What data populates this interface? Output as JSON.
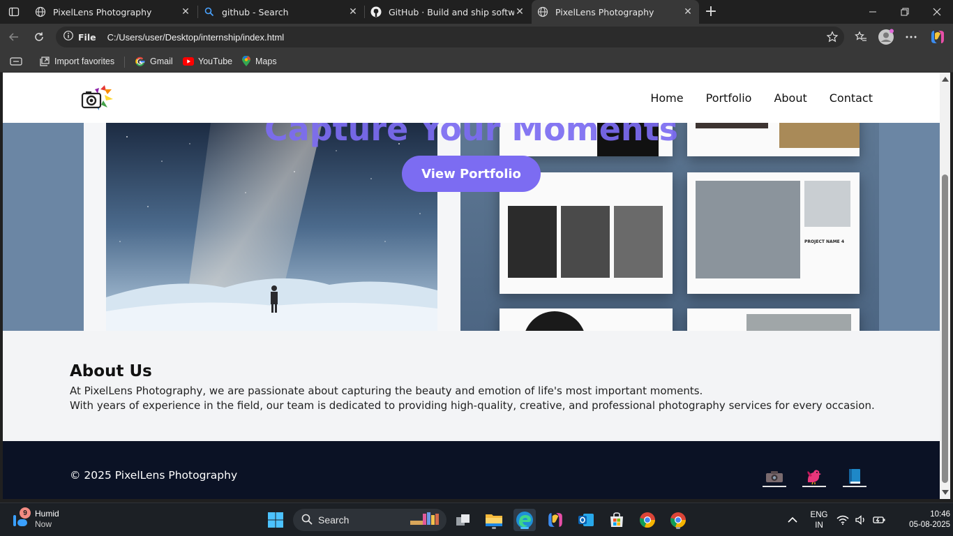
{
  "browser": {
    "tabs": [
      {
        "title": "PixelLens Photography",
        "favicon": "globe-icon",
        "active": false
      },
      {
        "title": "github - Search",
        "favicon": "search-icon",
        "active": false
      },
      {
        "title": "GitHub · Build and ship software o",
        "favicon": "github-icon",
        "active": false
      },
      {
        "title": "PixelLens Photography",
        "favicon": "globe-icon",
        "active": true
      }
    ],
    "address": {
      "scheme_label": "File",
      "url": "C:/Users/user/Desktop/internship/index.html"
    },
    "favorites": [
      {
        "label": "Import favorites",
        "icon": "import-icon"
      },
      {
        "label": "Gmail",
        "icon": "google-icon"
      },
      {
        "label": "YouTube",
        "icon": "youtube-icon"
      },
      {
        "label": "Maps",
        "icon": "maps-pin-icon"
      }
    ]
  },
  "site": {
    "nav": [
      "Home",
      "Portfolio",
      "About",
      "Contact"
    ],
    "hero": {
      "title": "Capture Your Moments",
      "button": "View Portfolio",
      "spread_text": "PROJECT NAME 4"
    },
    "about": {
      "heading": "About Us",
      "line1": "At PixelLens Photography, we are passionate about capturing the beauty and emotion of life's most important moments.",
      "line2": "With years of experience in the field, our team is dedicated to providing high-quality, creative, and professional photography services for every occasion."
    },
    "footer": {
      "copyright": "© 2025 PixelLens Photography",
      "social": [
        "camera-icon",
        "bird-icon",
        "book-icon"
      ]
    },
    "colors": {
      "accent": "#7c6cf2",
      "footer_bg": "#0b1225",
      "about_bg": "#f3f4f6"
    }
  },
  "taskbar": {
    "weather": {
      "badge": "9",
      "title": "Humid",
      "subtitle": "Now"
    },
    "search_label": "Search",
    "language": {
      "line1": "ENG",
      "line2": "IN"
    },
    "clock": {
      "time": "10:46",
      "date": "05-08-2025"
    }
  }
}
